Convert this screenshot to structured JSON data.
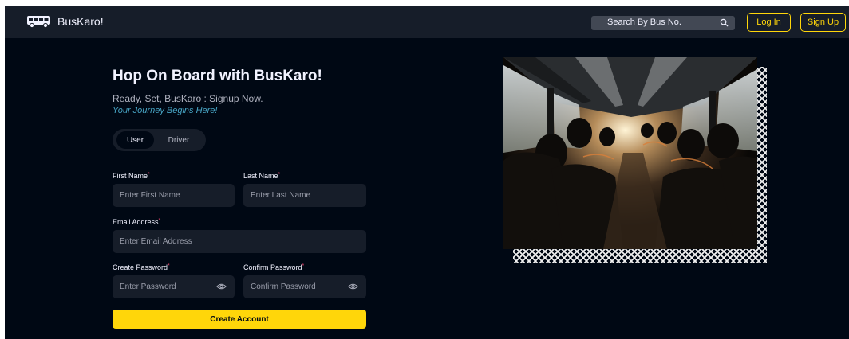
{
  "nav": {
    "brand": "BusKaro!",
    "search_placeholder": "Search By Bus No.",
    "login": "Log In",
    "signup": "Sign Up"
  },
  "hero": {
    "title": "Hop On Board with BusKaro!",
    "subtitle": "Ready, Set, BusKaro : Signup Now.",
    "tagline": "Your Journey Begins Here!"
  },
  "role_tabs": {
    "user": "User",
    "driver": "Driver",
    "selected": "User"
  },
  "form": {
    "first_name_label": "First Name",
    "first_name_placeholder": "Enter First Name",
    "last_name_label": "Last Name",
    "last_name_placeholder": "Enter Last Name",
    "email_label": "Email Address",
    "email_placeholder": "Enter Email Address",
    "password_label": "Create Password",
    "password_placeholder": "Enter Password",
    "confirm_label": "Confirm Password",
    "confirm_placeholder": "Confirm Password",
    "required_mark": "*",
    "submit": "Create Account"
  },
  "colors": {
    "background": "#000814",
    "surface": "#161d29",
    "accent": "#ffd60a",
    "link": "#47a5c5",
    "required": "#ef476f"
  }
}
